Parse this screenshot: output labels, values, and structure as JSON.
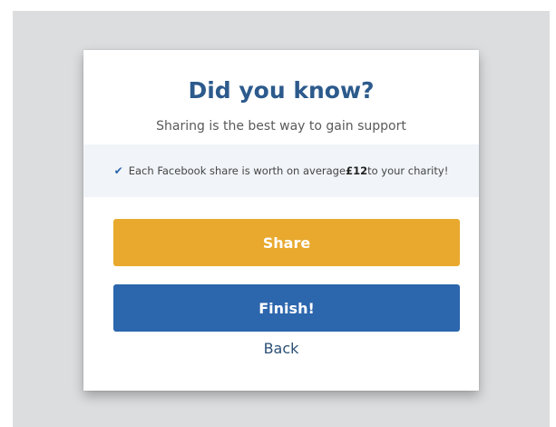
{
  "modal": {
    "title": "Did you know?",
    "subtitle": "Sharing is the best way to gain support",
    "info": {
      "icon": "check-icon",
      "prefix": "Each Facebook share is worth on average ",
      "amount": "£12",
      "suffix": " to your charity!"
    },
    "share_label": "Share",
    "finish_label": "Finish!",
    "back_label": "Back"
  },
  "colors": {
    "title": "#2c5a8c",
    "share": "#e8a92e",
    "finish": "#2c66ad",
    "backdrop": "#dcdddf"
  }
}
